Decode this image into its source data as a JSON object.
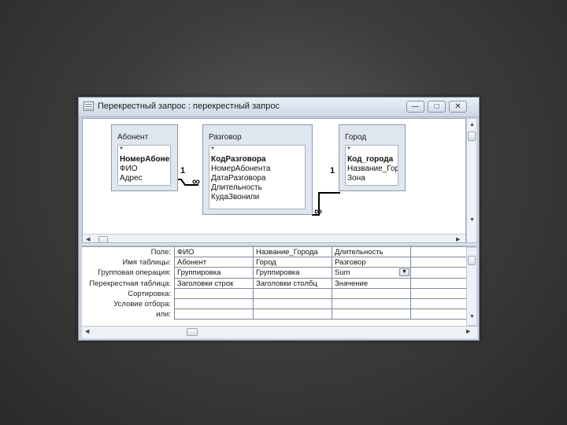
{
  "window": {
    "title": "Перекрестный запрос : перекрестный запрос",
    "minimize_glyph": "—",
    "maximize_glyph": "□",
    "close_glyph": "✕",
    "icon": "query-icon"
  },
  "tables": [
    {
      "name": "Абонент",
      "fields": [
        {
          "label": "*",
          "key": false
        },
        {
          "label": "НомерАбонент",
          "key": true
        },
        {
          "label": "ФИО",
          "key": false
        },
        {
          "label": "Адрес",
          "key": false
        }
      ]
    },
    {
      "name": "Разговор",
      "fields": [
        {
          "label": "*",
          "key": false
        },
        {
          "label": "КодРазговора",
          "key": true
        },
        {
          "label": "НомерАбонента",
          "key": false
        },
        {
          "label": "ДатаРазговора",
          "key": false
        },
        {
          "label": "Длительность",
          "key": false
        },
        {
          "label": "КудаЗвонили",
          "key": false
        }
      ]
    },
    {
      "name": "Город",
      "fields": [
        {
          "label": "*",
          "key": false
        },
        {
          "label": "Код_города",
          "key": true
        },
        {
          "label": "Название_Горо",
          "key": false
        },
        {
          "label": "Зона",
          "key": false
        }
      ]
    }
  ],
  "relations": {
    "one": "1",
    "many": "∞"
  },
  "grid": {
    "row_labels": [
      "Поле:",
      "Имя таблицы:",
      "Групповая операция:",
      "Перекрестная таблица:",
      "Сортировка:",
      "Условие отбора:",
      "или:"
    ],
    "columns": [
      {
        "cells": [
          "ФИО",
          "Абонент",
          "Группировка",
          "Заголовки строк",
          "",
          "",
          ""
        ]
      },
      {
        "cells": [
          "Название_Города",
          "Город",
          "Группировка",
          "Заголовки столбц",
          "",
          "",
          ""
        ]
      },
      {
        "cells": [
          "Длительность",
          "Разговор",
          "Sum",
          "Значение",
          "",
          "",
          ""
        ]
      },
      {
        "cells": [
          "",
          "",
          "",
          "",
          "",
          "",
          ""
        ]
      }
    ],
    "active_combo_icon": "dropdown-arrow-icon"
  }
}
